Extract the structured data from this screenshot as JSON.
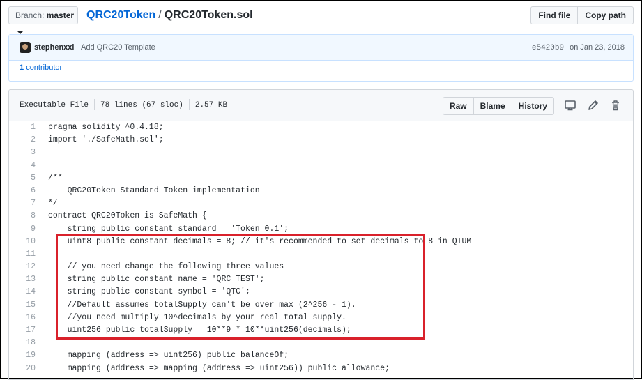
{
  "topbar": {
    "branch_prefix": "Branch:",
    "branch_name": "master",
    "repo": "QRC20Token",
    "separator": "/",
    "file": "QRC20Token.sol",
    "find_file": "Find file",
    "copy_path": "Copy path"
  },
  "commit": {
    "author": "stephenxxl",
    "message": "Add QRC20 Template",
    "sha": "e5420b9",
    "date": "on Jan 23, 2018",
    "contributors_count": "1",
    "contributors_label": "contributor"
  },
  "file_header": {
    "mode": "Executable File",
    "lines": "78 lines (67 sloc)",
    "size": "2.57 KB",
    "raw": "Raw",
    "blame": "Blame",
    "history": "History",
    "icons": [
      "desktop-icon",
      "pencil-icon",
      "trash-icon"
    ]
  },
  "code": [
    {
      "n": "1",
      "t": "pragma solidity ^0.4.18;"
    },
    {
      "n": "2",
      "t": "import './SafeMath.sol';"
    },
    {
      "n": "3",
      "t": ""
    },
    {
      "n": "4",
      "t": ""
    },
    {
      "n": "5",
      "t": "/**"
    },
    {
      "n": "6",
      "t": "    QRC20Token Standard Token implementation"
    },
    {
      "n": "7",
      "t": "*/"
    },
    {
      "n": "8",
      "t": "contract QRC20Token is SafeMath {"
    },
    {
      "n": "9",
      "t": "    string public constant standard = 'Token 0.1';"
    },
    {
      "n": "10",
      "t": "    uint8 public constant decimals = 8; // it's recommended to set decimals to 8 in QTUM"
    },
    {
      "n": "11",
      "t": ""
    },
    {
      "n": "12",
      "t": "    // you need change the following three values"
    },
    {
      "n": "13",
      "t": "    string public constant name = 'QRC TEST';"
    },
    {
      "n": "14",
      "t": "    string public constant symbol = 'QTC';"
    },
    {
      "n": "15",
      "t": "    //Default assumes totalSupply can't be over max (2^256 - 1)."
    },
    {
      "n": "16",
      "t": "    //you need multiply 10^decimals by your real total supply."
    },
    {
      "n": "17",
      "t": "    uint256 public totalSupply = 10**9 * 10**uint256(decimals);"
    },
    {
      "n": "18",
      "t": ""
    },
    {
      "n": "19",
      "t": "    mapping (address => uint256) public balanceOf;"
    },
    {
      "n": "20",
      "t": "    mapping (address => mapping (address => uint256)) public allowance;"
    }
  ],
  "colors": {
    "link": "#0366d6",
    "highlight_border": "#d9212b"
  }
}
